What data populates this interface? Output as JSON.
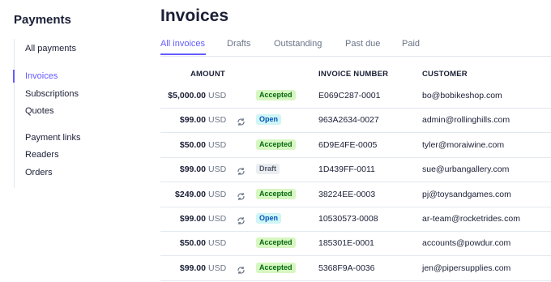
{
  "sidebar": {
    "title": "Payments",
    "items": [
      {
        "label": "All payments"
      },
      {
        "label": "Invoices"
      },
      {
        "label": "Subscriptions"
      },
      {
        "label": "Quotes"
      },
      {
        "label": "Payment links"
      },
      {
        "label": "Readers"
      },
      {
        "label": "Orders"
      }
    ]
  },
  "main": {
    "title": "Invoices",
    "tabs": [
      {
        "label": "All invoices"
      },
      {
        "label": "Drafts"
      },
      {
        "label": "Outstanding"
      },
      {
        "label": "Past due"
      },
      {
        "label": "Paid"
      }
    ],
    "columns": {
      "amount": "AMOUNT",
      "invoice_number": "INVOICE NUMBER",
      "customer": "CUSTOMER"
    },
    "rows": [
      {
        "amount": "$5,000.00",
        "currency": "USD",
        "recurring": false,
        "status": "Accepted",
        "invoice_number": "E069C287-0001",
        "customer": "bo@bobikeshop.com"
      },
      {
        "amount": "$99.00",
        "currency": "USD",
        "recurring": true,
        "status": "Open",
        "invoice_number": "963A2634-0027",
        "customer": "admin@rollinghills.com"
      },
      {
        "amount": "$50.00",
        "currency": "USD",
        "recurring": false,
        "status": "Accepted",
        "invoice_number": "6D9E4FE-0005",
        "customer": "tyler@moraiwine.com"
      },
      {
        "amount": "$99.00",
        "currency": "USD",
        "recurring": true,
        "status": "Draft",
        "invoice_number": "1D439FF-0011",
        "customer": "sue@urbangallery.com"
      },
      {
        "amount": "$249.00",
        "currency": "USD",
        "recurring": true,
        "status": "Accepted",
        "invoice_number": "38224EE-0003",
        "customer": "pj@toysandgames.com"
      },
      {
        "amount": "$99.00",
        "currency": "USD",
        "recurring": true,
        "status": "Open",
        "invoice_number": "10530573-0008",
        "customer": "ar-team@rocketrides.com"
      },
      {
        "amount": "$50.00",
        "currency": "USD",
        "recurring": false,
        "status": "Accepted",
        "invoice_number": "185301E-0001",
        "customer": "accounts@powdur.com"
      },
      {
        "amount": "$99.00",
        "currency": "USD",
        "recurring": true,
        "status": "Accepted",
        "invoice_number": "5368F9A-0036",
        "customer": "jen@pipersupplies.com"
      }
    ]
  },
  "colors": {
    "accent": "#635bff",
    "accepted_bg": "#d7f7c2",
    "open_bg": "#cff5f6",
    "draft_bg": "#ebeef1"
  }
}
